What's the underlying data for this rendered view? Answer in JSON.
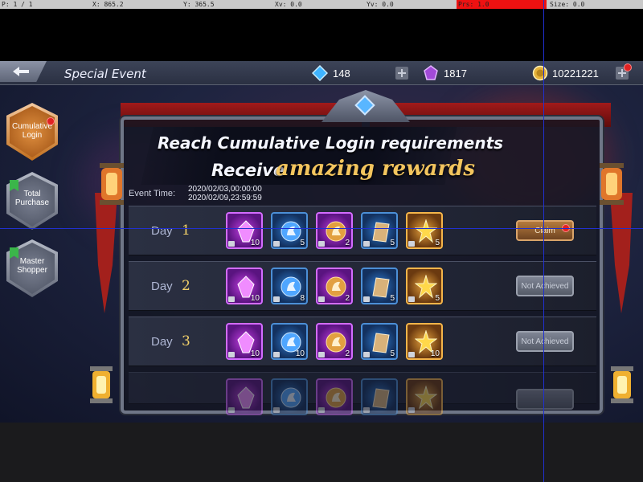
{
  "debug": {
    "pointer": "P: 1 / 1",
    "x": "X: 865.2",
    "y": "Y: 365.5",
    "xv": "Xv: 0.0",
    "yv": "Yv: 0.0",
    "prs": "Prs: 1.0",
    "size": "Size: 0.0"
  },
  "header": {
    "title": "Special Event",
    "gems": "148",
    "crystals": "1817",
    "gold": "10221221"
  },
  "tabs": [
    {
      "label_line1": "Cumulative",
      "label_line2": "Login",
      "active": true,
      "badge": "red-dot"
    },
    {
      "label_line1": "Total",
      "label_line2": "Purchase",
      "active": false
    },
    {
      "label_line1": "Master",
      "label_line2": "Shopper",
      "active": false
    }
  ],
  "banner": {
    "line1": "Reach Cumulative Login requirements",
    "line2_prefix": "Receive",
    "line2_highlight": "amazing rewards"
  },
  "event_time": {
    "label": "Event Time:",
    "start": "2020/02/03,00:00:00",
    "end": "2020/02/09,23:59:59"
  },
  "days": [
    {
      "label": "Day",
      "number": "1",
      "rewards": [
        "10",
        "5",
        "2",
        "5",
        "5"
      ],
      "button": "Claim",
      "status": "claimable"
    },
    {
      "label": "Day",
      "number": "2",
      "rewards": [
        "10",
        "8",
        "2",
        "5",
        "5"
      ],
      "button": "Not Achieved",
      "status": "locked"
    },
    {
      "label": "Day",
      "number": "3",
      "rewards": [
        "10",
        "10",
        "2",
        "5",
        "10"
      ],
      "button": "Not Achieved",
      "status": "locked"
    }
  ],
  "reward_types": [
    "purple-crystal-icon",
    "blue-horse-emblem-icon",
    "gold-horse-emblem-icon",
    "scroll-card-icon",
    "gold-star-icon"
  ],
  "colors": {
    "accent_gold": "#f3c55e",
    "claim": "#b47a3e",
    "disabled": "#7f8594",
    "badge": "#e02222"
  }
}
